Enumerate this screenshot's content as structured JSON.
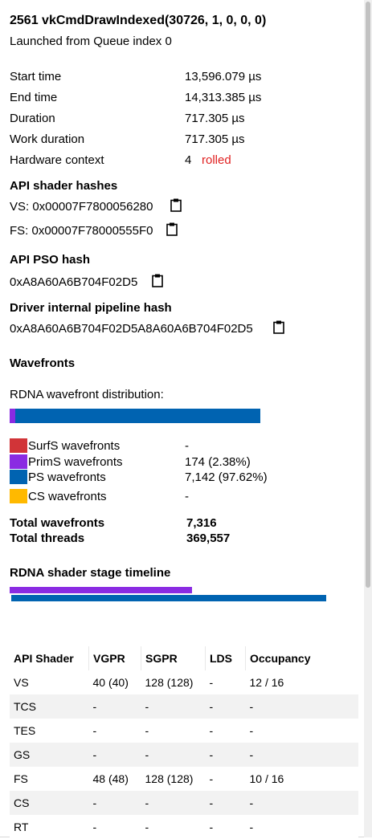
{
  "header": {
    "title": "2561 vkCmdDrawIndexed(30726, 1, 0, 0, 0)",
    "subtitle": "Launched from Queue index 0"
  },
  "timing": [
    {
      "label": "Start time",
      "value": "13,596.079 µs"
    },
    {
      "label": "End time",
      "value": "14,313.385 µs"
    },
    {
      "label": "Duration",
      "value": "717.305 µs"
    },
    {
      "label": "Work duration",
      "value": "717.305 µs"
    }
  ],
  "hardware_context": {
    "label": "Hardware context",
    "value": "4",
    "status": "rolled"
  },
  "api_shader_hashes": {
    "heading": "API shader hashes",
    "vs": "VS: 0x00007F7800056280",
    "fs": "FS: 0x00007F78000555F0"
  },
  "api_pso_hash": {
    "heading": "API PSO hash",
    "value": "0xA8A60A6B704F02D5"
  },
  "driver_pipeline_hash": {
    "heading": "Driver internal pipeline hash",
    "value": "0xA8A60A6B704F02D5A8A60A6B704F02D5"
  },
  "wavefronts": {
    "heading": "Wavefronts",
    "distribution_label": "RDNA wavefront distribution:",
    "distribution": [
      {
        "stage": "SurfS",
        "fraction": 0.0,
        "color": "#d13438"
      },
      {
        "stage": "PrimS",
        "fraction": 0.0238,
        "color": "#8a2be2"
      },
      {
        "stage": "PS",
        "fraction": 0.9762,
        "color": "#0063b1"
      },
      {
        "stage": "CS",
        "fraction": 0.0,
        "color": "#ffb900"
      }
    ],
    "legend": [
      {
        "label": "SurfS wavefronts",
        "value": "-",
        "color": "#d13438"
      },
      {
        "label": "PrimS wavefronts",
        "value": "174 (2.38%)",
        "color": "#8a2be2"
      },
      {
        "label": "PS wavefronts",
        "value": "7,142 (97.62%)",
        "color": "#0063b1"
      },
      {
        "label": "CS wavefronts",
        "value": "-",
        "color": "#ffb900"
      }
    ],
    "totals": [
      {
        "label": "Total wavefronts",
        "value": "7,316"
      },
      {
        "label": "Total threads",
        "value": "369,557"
      }
    ]
  },
  "timeline": {
    "heading": "RDNA shader stage timeline",
    "bars": [
      {
        "stage": "PrimS",
        "start": 0.0,
        "end": 0.58,
        "color": "#8a2be2"
      },
      {
        "stage": "PS",
        "start": 0.0,
        "end": 1.0,
        "color": "#0063b1"
      }
    ]
  },
  "shader_table": {
    "columns": [
      "API Shader",
      "VGPR",
      "SGPR",
      "LDS",
      "Occupancy"
    ],
    "rows": [
      [
        "VS",
        "40 (40)",
        "128 (128)",
        "-",
        "12 / 16"
      ],
      [
        "TCS",
        "-",
        "-",
        "-",
        "-"
      ],
      [
        "TES",
        "-",
        "-",
        "-",
        "-"
      ],
      [
        "GS",
        "-",
        "-",
        "-",
        "-"
      ],
      [
        "FS",
        "48 (48)",
        "128 (128)",
        "-",
        "10 / 16"
      ],
      [
        "CS",
        "-",
        "-",
        "-",
        "-"
      ],
      [
        "RT",
        "-",
        "-",
        "-",
        "-"
      ]
    ]
  },
  "icons": {
    "copy": "clipboard-icon"
  }
}
